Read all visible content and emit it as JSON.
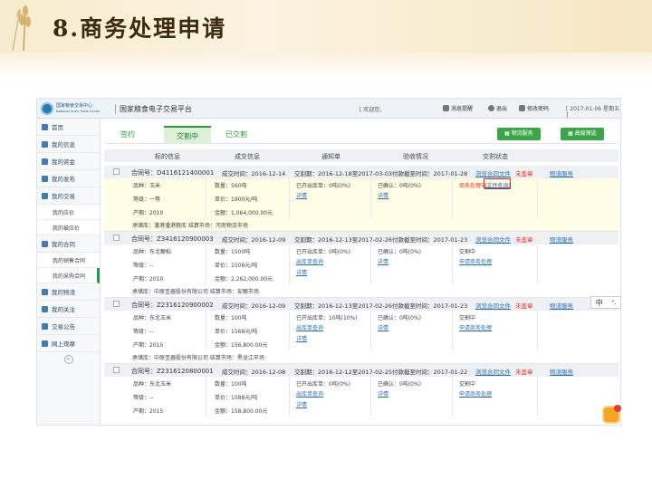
{
  "slide": {
    "title": "8.商务处理申请"
  },
  "app": {
    "logo_line1": "国家粮食交易中心",
    "logo_line2": "National Grain Trade Center",
    "platform_name": "国家粮食电子交易平台",
    "welcome": "[ 欢迎您，",
    "messages": "消息提醒",
    "logout": "退出",
    "change_pw": "修改密码",
    "date": "[ 2017-01-06 星期五 ]"
  },
  "sidebar": {
    "items": [
      {
        "label": "首页"
      },
      {
        "label": "我的信息"
      },
      {
        "label": "我的资金"
      },
      {
        "label": "我的发布"
      },
      {
        "label": "我的交易"
      }
    ],
    "trade_sub": [
      "我的应价",
      "我的被应价"
    ],
    "contract_label": "我的合同",
    "contract_sub": [
      "我的销售合同",
      "我的采购合同"
    ],
    "items2": [
      {
        "label": "我的物流"
      },
      {
        "label": "我的关注"
      },
      {
        "label": "交易公告"
      },
      {
        "label": "网上观摩"
      }
    ]
  },
  "tabs": {
    "sign": "签约",
    "trading": "交割中",
    "done": "已交割",
    "logistics_btn": "物流服务",
    "filter_btn": "高级筛选"
  },
  "table_headers": [
    "标的信息",
    "成交信息",
    "通知单",
    "验收情况",
    "交割状态"
  ],
  "orders": [
    {
      "contract": "合同号：D4116121400001",
      "deal_time": "成交时间：2016-12-14",
      "period": "交割期：2016-12-18至2017-03-03",
      "pay_deadline": "付款截至时间：2017-01-28",
      "view_contract": "浏览合同文件",
      "stamp": "未盖章",
      "logistics": "物流服务",
      "name": "品种：玉米",
      "grade": "等级：一等",
      "year": "产期：2010",
      "qty": "数量：560吨",
      "price": "单价：1900元/吨",
      "amount": "金额：1,064,000.00元",
      "outbound": "已开出库单：0吨(0%)",
      "detail1": "详情",
      "accepted": "已确认：0吨(0%)",
      "detail2": "详情",
      "status": "商务处理中",
      "status_link": "(文件查询)",
      "status2": "",
      "depot": "承储库：潘港潘港粮库    结算市场：河南物流市场"
    },
    {
      "contract": "合同号：Z3416120900003",
      "deal_time": "成交时间：2016-12-09",
      "period": "交割期：2016-12-13至2017-02-26",
      "pay_deadline": "付款截至时间：2017-01-23",
      "view_contract": "浏览合同文件",
      "stamp": "未盖章",
      "logistics": "物流服务",
      "name": "品种：东北粳稻",
      "grade": "等级：--",
      "year": "产期：2010",
      "qty": "数量：1500吨",
      "price": "单价：1508元/吨",
      "amount": "金额：2,262,000.00元",
      "outbound": "已开出库单：0吨(0%)",
      "detail1": "出库单查询",
      "detail1b": "详情",
      "accepted": "已确认：0吨(0%)",
      "detail2": "详情",
      "status": "交割中",
      "status_link": "",
      "status2": "申请商务处理",
      "depot": "承储库：中原圣器股份有限公司    结算市场：安徽市场"
    },
    {
      "contract": "合同号：Z2316120900002",
      "deal_time": "成交时间：2016-12-09",
      "period": "交割期：2016-12-13至2017-02-26",
      "pay_deadline": "付款截至时间：2017-01-23",
      "view_contract": "浏览合同文件",
      "stamp": "未盖章",
      "logistics": "物流服务",
      "name": "品种：东北玉米",
      "grade": "等级：--",
      "year": "产期：2015",
      "qty": "数量：100吨",
      "price": "单价：1568元/吨",
      "amount": "金额：156,800.00元",
      "outbound": "已开出库单：10吨(10%)",
      "detail1": "出库单查询",
      "detail1b": "详情",
      "accepted": "已确认：0吨(0%)",
      "detail2": "详情",
      "status": "交割中",
      "status_link": "",
      "status2": "申请商务处理",
      "depot": "承储库：中原圣器股份有限公司    结算市场：黑龙江市场"
    },
    {
      "contract": "合同号：Z2316120800001",
      "deal_time": "成交时间：2016-12-08",
      "period": "交割期：2016-12-12至2017-02-25",
      "pay_deadline": "付款截至时间：2017-01-22",
      "view_contract": "浏览合同文件",
      "stamp": "未盖章",
      "logistics": "物流服务",
      "name": "品种：东北玉米",
      "grade": "等级：--",
      "year": "产期：2015",
      "qty": "数量：100吨",
      "price": "单价：1588元/吨",
      "amount": "金额：158,800.00元",
      "outbound": "已开出库单：0吨(0%)",
      "detail1": "出库单查询",
      "detail1b": "详情",
      "accepted": "已确认：0吨(0%)",
      "detail2": "详情",
      "status": "交割中",
      "status_link": "",
      "status2": "申请商务处理",
      "depot": ""
    }
  ],
  "float": {
    "lang": "中",
    "mode": "°,"
  }
}
